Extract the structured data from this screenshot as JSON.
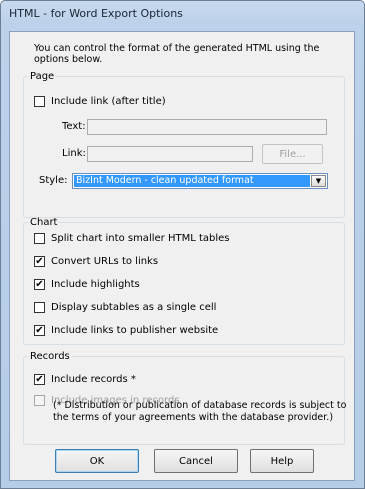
{
  "window": {
    "title": "HTML - for Word Export Options"
  },
  "intro": "You can control the format of the generated HTML using the options below.",
  "page": {
    "legend": "Page",
    "include_link_label": "Include link (after title)",
    "include_link_checked": false,
    "text_label": "Text:",
    "text_value": "",
    "link_label": "Link:",
    "link_value": "",
    "file_button": "File...",
    "style_label": "Style:",
    "style_value": "BizInt Modern - clean updated format"
  },
  "chart": {
    "legend": "Chart",
    "options": [
      {
        "label": "Split chart into smaller HTML tables",
        "checked": false
      },
      {
        "label": "Convert URLs to links",
        "checked": true
      },
      {
        "label": "Include highlights",
        "checked": true
      },
      {
        "label": "Display subtables as a single cell",
        "checked": false
      },
      {
        "label": "Include links to publisher website",
        "checked": true
      }
    ]
  },
  "records": {
    "legend": "Records",
    "include_records_label": "Include records *",
    "include_records_checked": true,
    "include_images_label": "Include images in records",
    "include_images_checked": false,
    "note": "(* Distribution or publication of database records is subject to the terms of your agreements with the database provider.)"
  },
  "buttons": {
    "ok": "OK",
    "cancel": "Cancel",
    "help": "Help"
  }
}
